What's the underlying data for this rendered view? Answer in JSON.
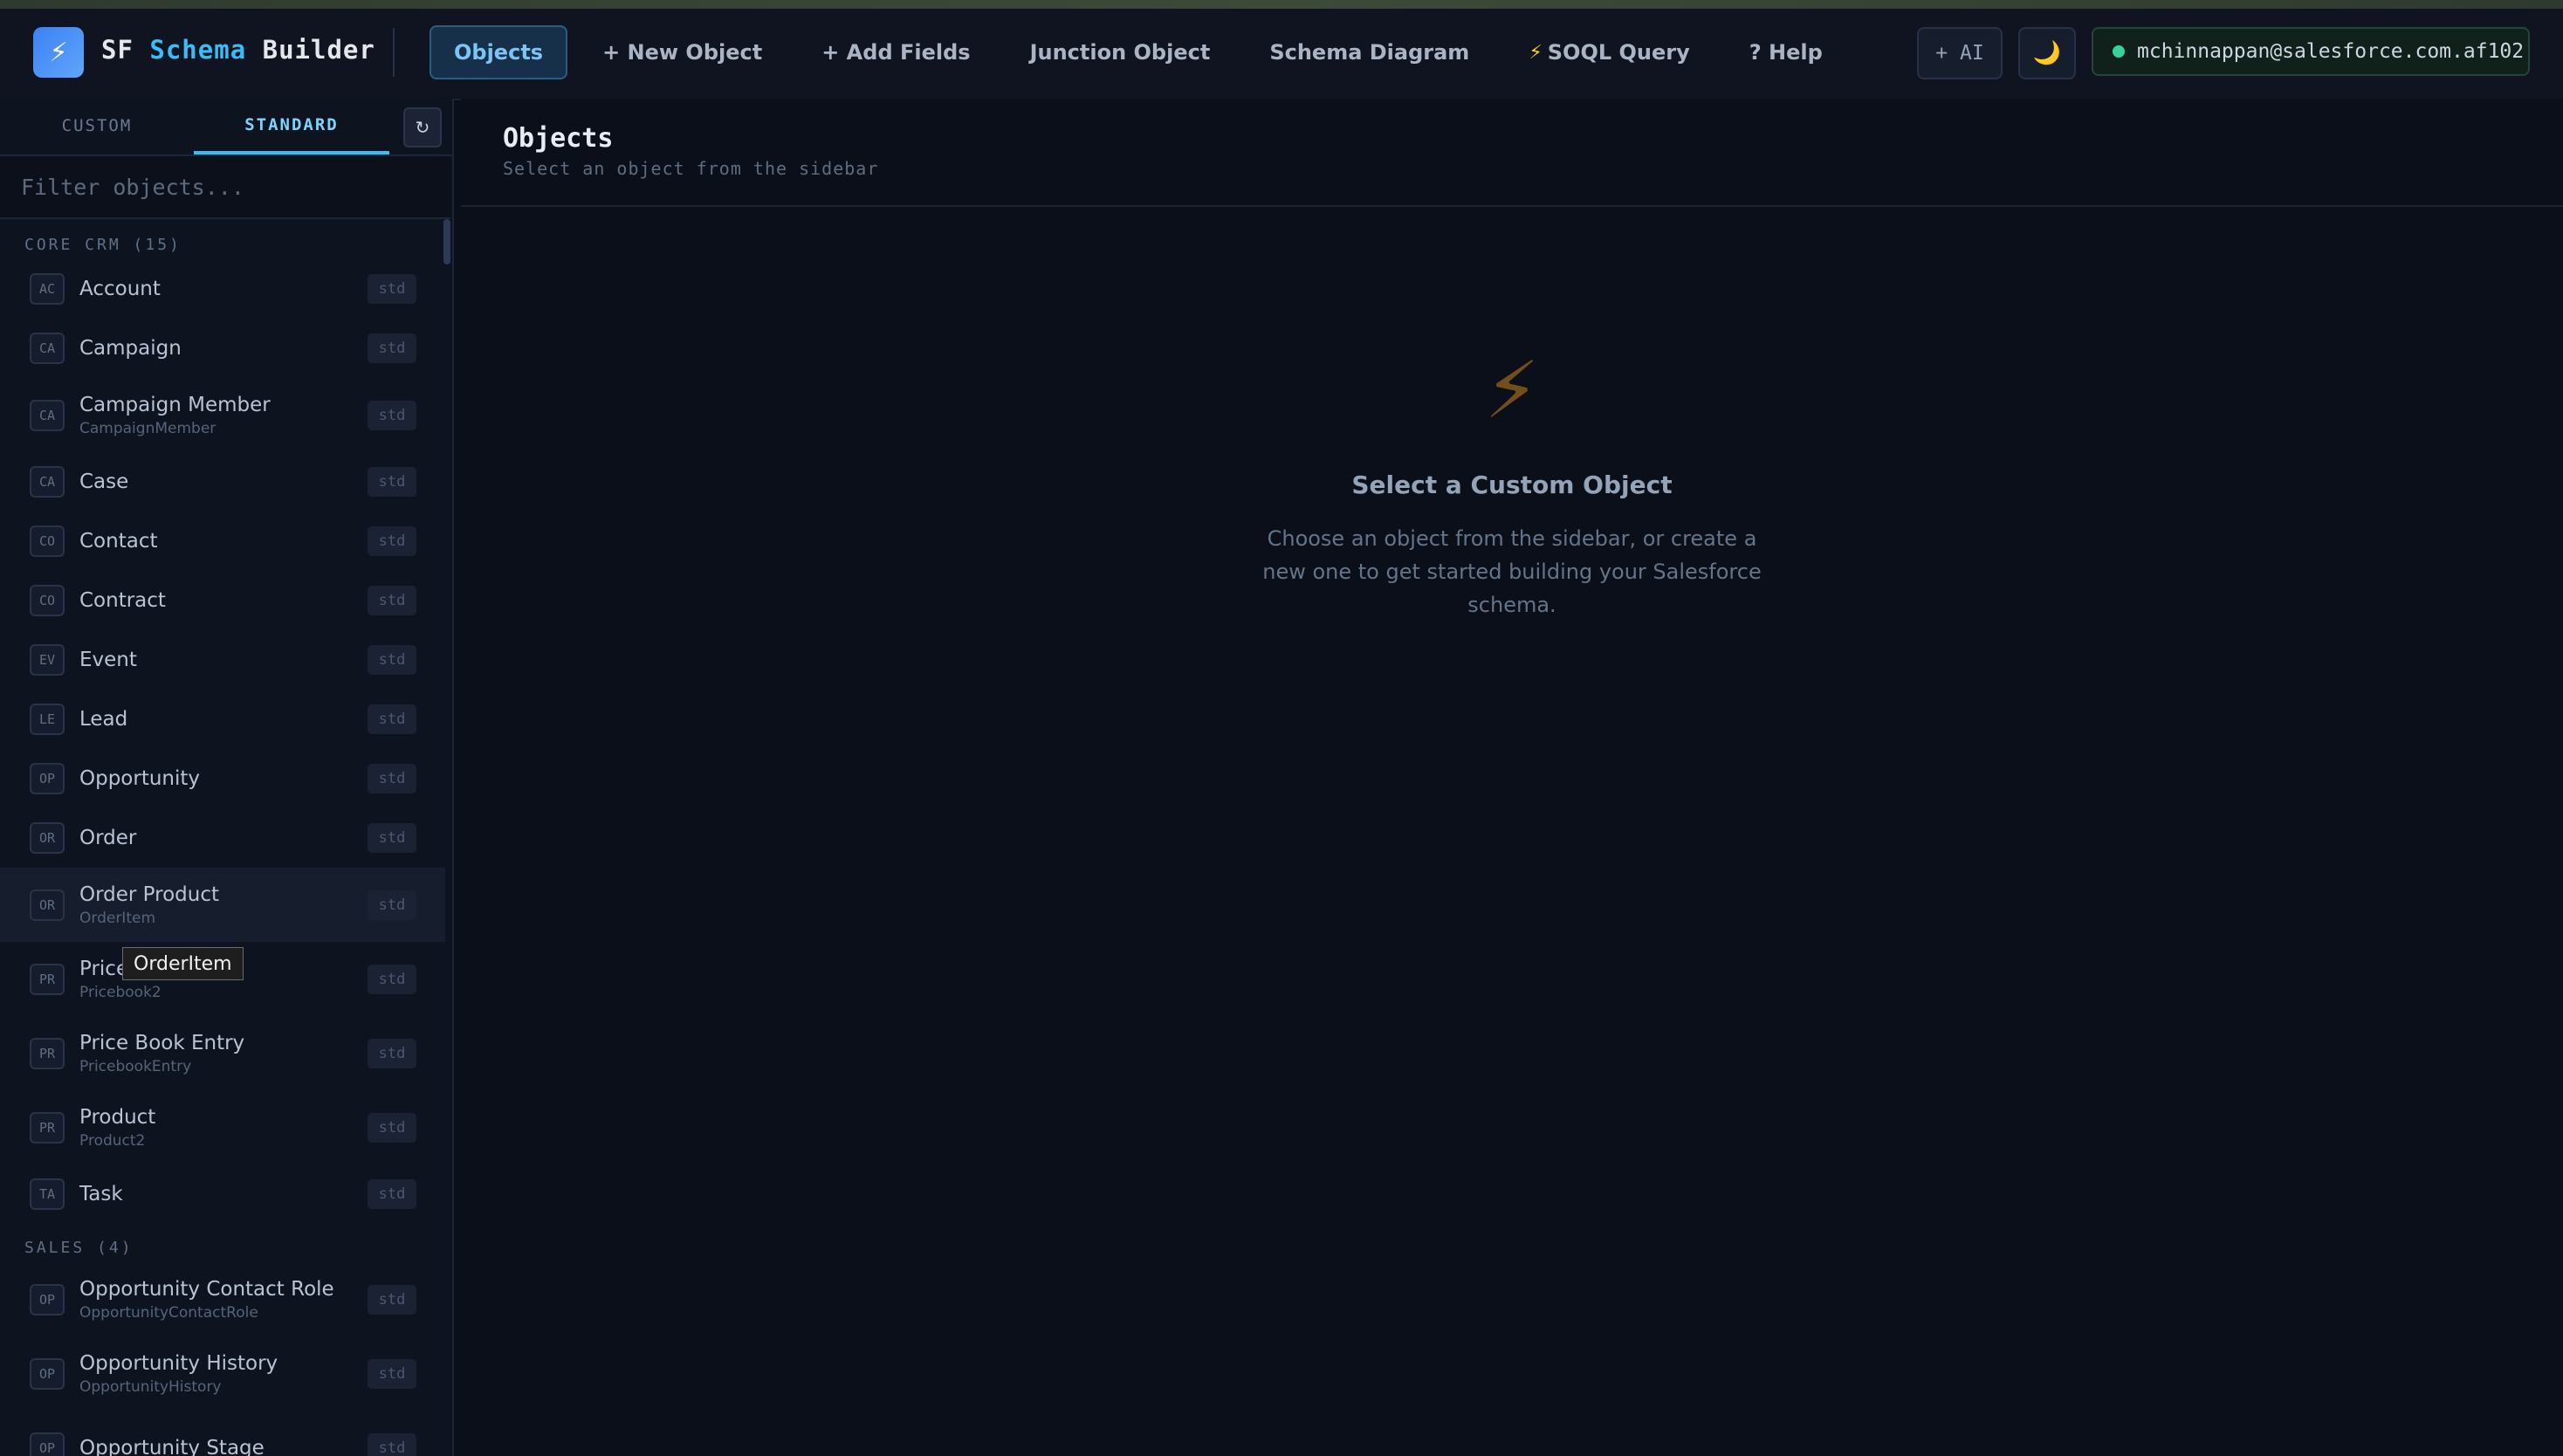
{
  "brand": {
    "part1": "SF",
    "part2": "Schema",
    "part3": "Builder",
    "logo_icon": "lightning-bolt"
  },
  "nav": [
    {
      "label": "Objects",
      "active": true
    },
    {
      "label": "+ New Object"
    },
    {
      "label": "+ Add Fields"
    },
    {
      "label": "Junction Object"
    },
    {
      "label": "Schema Diagram"
    },
    {
      "label": "SOQL Query",
      "icon": "lightning-bolt"
    },
    {
      "label": "? Help"
    }
  ],
  "header_right": {
    "ai_label": "+ AI",
    "theme_icon": "moon",
    "user": "mchinnappan@salesforce.com.af102",
    "status_color": "#34d399"
  },
  "sidebar": {
    "tabs": {
      "custom": "CUSTOM",
      "standard": "STANDARD",
      "active": "standard"
    },
    "refresh_icon": "↻",
    "filter_placeholder": "Filter objects...",
    "groups": [
      {
        "title": "CORE CRM (15)",
        "items": [
          {
            "abbr": "AC",
            "label": "Account",
            "badge": "std"
          },
          {
            "abbr": "CA",
            "label": "Campaign",
            "badge": "std"
          },
          {
            "abbr": "CA",
            "label": "Campaign Member",
            "api": "CampaignMember",
            "badge": "std"
          },
          {
            "abbr": "CA",
            "label": "Case",
            "badge": "std"
          },
          {
            "abbr": "CO",
            "label": "Contact",
            "badge": "std"
          },
          {
            "abbr": "CO",
            "label": "Contract",
            "badge": "std"
          },
          {
            "abbr": "EV",
            "label": "Event",
            "badge": "std"
          },
          {
            "abbr": "LE",
            "label": "Lead",
            "badge": "std"
          },
          {
            "abbr": "OP",
            "label": "Opportunity",
            "badge": "std"
          },
          {
            "abbr": "OR",
            "label": "Order",
            "badge": "std"
          },
          {
            "abbr": "OR",
            "label": "Order Product",
            "api": "OrderItem",
            "badge": "std",
            "hovered": true
          },
          {
            "abbr": "PR",
            "label": "Price Book",
            "api": "Pricebook2",
            "badge": "std"
          },
          {
            "abbr": "PR",
            "label": "Price Book Entry",
            "api": "PricebookEntry",
            "badge": "std"
          },
          {
            "abbr": "PR",
            "label": "Product",
            "api": "Product2",
            "badge": "std"
          },
          {
            "abbr": "TA",
            "label": "Task",
            "badge": "std"
          }
        ]
      },
      {
        "title": "SALES (4)",
        "items": [
          {
            "abbr": "OP",
            "label": "Opportunity Contact Role",
            "api": "OpportunityContactRole",
            "badge": "std"
          },
          {
            "abbr": "OP",
            "label": "Opportunity History",
            "api": "OpportunityHistory",
            "badge": "std"
          },
          {
            "abbr": "OP",
            "label": "Opportunity Stage",
            "badge": "std"
          }
        ]
      }
    ],
    "tooltip": "OrderItem"
  },
  "main": {
    "title": "Objects",
    "subtitle": "Select an object from the sidebar",
    "empty_icon": "lightning-bolt",
    "empty_title": "Select a Custom Object",
    "empty_desc": "Choose an object from the sidebar, or create a new one to get started building your Salesforce schema."
  }
}
